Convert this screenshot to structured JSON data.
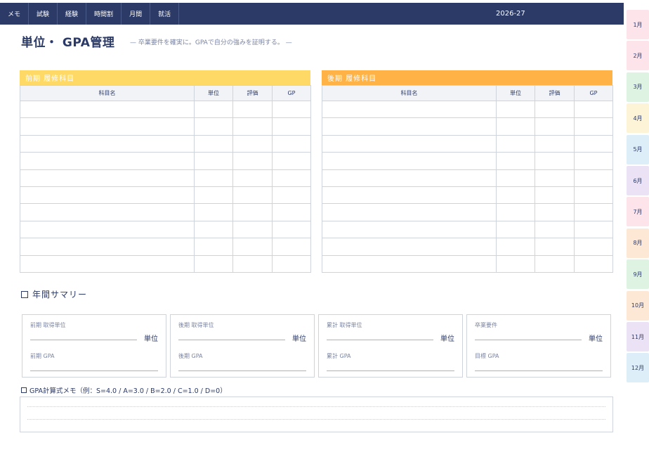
{
  "nav": {
    "items": [
      "メモ",
      "試験",
      "経験",
      "時間割",
      "月間",
      "就活"
    ],
    "year": "2026-27"
  },
  "month_tabs": [
    {
      "label": "1月",
      "color": "#fde3ea"
    },
    {
      "label": "2月",
      "color": "#fde3ea"
    },
    {
      "label": "3月",
      "color": "#dff3e3"
    },
    {
      "label": "4月",
      "color": "#fdf3d6"
    },
    {
      "label": "5月",
      "color": "#ddeef8"
    },
    {
      "label": "6月",
      "color": "#ebe3f5"
    },
    {
      "label": "7月",
      "color": "#fde3ea"
    },
    {
      "label": "8月",
      "color": "#fde8d6"
    },
    {
      "label": "9月",
      "color": "#dff3e3"
    },
    {
      "label": "10月",
      "color": "#fde8d6"
    },
    {
      "label": "11月",
      "color": "#ebe3f5"
    },
    {
      "label": "12月",
      "color": "#ddeef8"
    }
  ],
  "page": {
    "title": "単位・ GPA管理",
    "subtitle": "— 卒業要件を確実に。GPAで自分の強みを証明する。 —"
  },
  "first_semester": {
    "heading": "前期 履修科目",
    "color": "#ffd966"
  },
  "second_semester": {
    "heading": "後期 履修科目",
    "color": "#ffb347"
  },
  "table": {
    "columns": [
      "科目名",
      "単位",
      "評価",
      "GP"
    ],
    "row_count": 10
  },
  "summary": {
    "title": "年間サマリー",
    "cards": [
      {
        "label1": "前期 取得単位",
        "unit": "単位",
        "label2": "前期 GPA"
      },
      {
        "label1": "後期 取得単位",
        "unit": "単位",
        "label2": "後期 GPA"
      },
      {
        "label1": "累計 取得単位",
        "unit": "単位",
        "label2": "累計 GPA"
      },
      {
        "label1": "卒業要件",
        "unit": "単位",
        "label2": "目標 GPA"
      }
    ]
  },
  "memo": {
    "title": "GPA計算式メモ（例：S=4.0 / A=3.0 / B=2.0 / C=1.0 / D=0）"
  }
}
